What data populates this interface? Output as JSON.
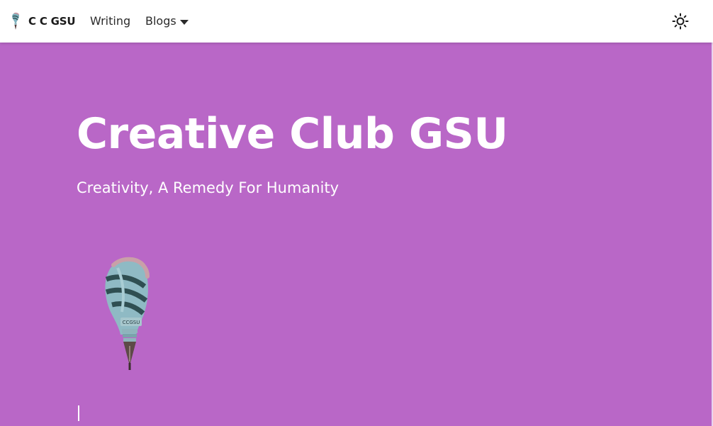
{
  "navbar": {
    "brand_text": "C C GSU",
    "logo_icon": "ccgsu-bulb-pen-logo",
    "links": [
      {
        "label": "Writing"
      },
      {
        "label": "Blogs",
        "has_dropdown": true
      }
    ],
    "theme_toggle_icon": "sun-icon"
  },
  "hero": {
    "title": "Creative Club GSU",
    "subtitle": "Creativity, A Remedy For Humanity",
    "logo_text": "CCGSU",
    "background_color": "#b967c7"
  }
}
